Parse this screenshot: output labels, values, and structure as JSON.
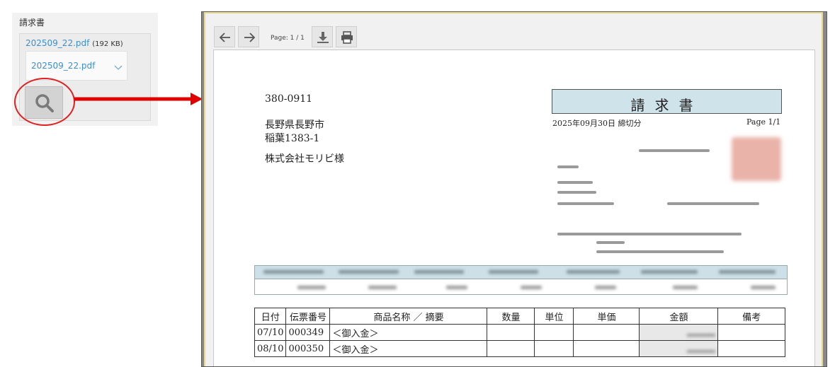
{
  "attachment": {
    "section_title": "請求書",
    "file_link": "202509_22.pdf",
    "file_size": "(192 KB)",
    "selected_file": "202509_22.pdf",
    "preview_icon": "magnifier-icon"
  },
  "annotation": {
    "circle_color": "#e02020",
    "arrow_color": "#e00000"
  },
  "viewer": {
    "page_label": "Page: 1 / 1",
    "tools": [
      "arrow-left-icon",
      "arrow-right-icon",
      "download-icon",
      "print-icon"
    ]
  },
  "invoice": {
    "postal_code": "380-0911",
    "address_line1": "長野県長野市",
    "address_line2": "稲葉1383-1",
    "recipient": "株式会社モリビ様",
    "title": "請求書",
    "closing_date": "2025年09月30日 締切分",
    "page": "Page 1/1",
    "detail_headers": [
      "日付",
      "伝票番号",
      "商品名称 ／ 摘要",
      "数量",
      "単位",
      "単価",
      "金額",
      "備考"
    ],
    "detail_rows": [
      {
        "date": "07/10",
        "slip": "000349",
        "item": "＜御入金＞"
      },
      {
        "date": "08/10",
        "slip": "000350",
        "item": "＜御入金＞"
      }
    ]
  }
}
